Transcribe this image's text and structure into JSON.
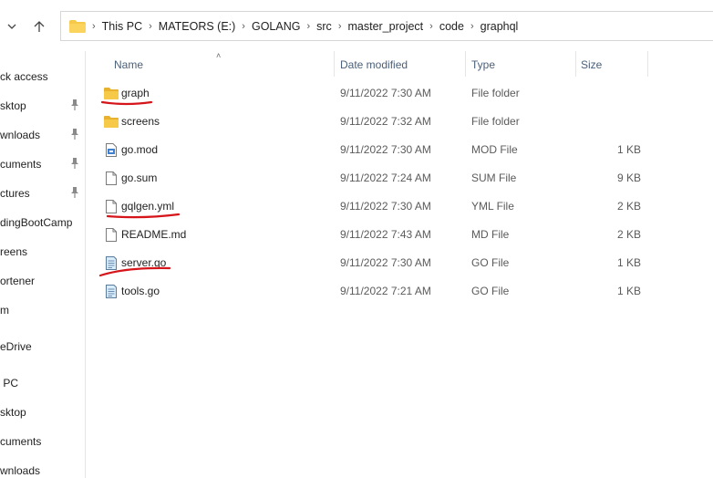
{
  "breadcrumbs": [
    "This PC",
    "MATEORS (E:)",
    "GOLANG",
    "src",
    "master_project",
    "code",
    "graphql"
  ],
  "sidebar": {
    "items": [
      {
        "label": "ck access",
        "pinned": false
      },
      {
        "label": "sktop",
        "pinned": true
      },
      {
        "label": "wnloads",
        "pinned": true
      },
      {
        "label": "cuments",
        "pinned": true
      },
      {
        "label": "ctures",
        "pinned": true
      },
      {
        "label": "dingBootCamp",
        "pinned": false
      },
      {
        "label": "reens",
        "pinned": false
      },
      {
        "label": "ortener",
        "pinned": false
      },
      {
        "label": "m",
        "pinned": false
      },
      {
        "label": "eDrive",
        "pinned": false
      },
      {
        "label": " PC",
        "pinned": false
      },
      {
        "label": "sktop",
        "pinned": false
      },
      {
        "label": "cuments",
        "pinned": false
      },
      {
        "label": "wnloads",
        "pinned": false
      }
    ]
  },
  "columns": {
    "name": "Name",
    "date": "Date modified",
    "type": "Type",
    "size": "Size"
  },
  "files": [
    {
      "name": "graph",
      "date": "9/11/2022 7:30 AM",
      "type": "File folder",
      "size": "",
      "icon": "folder-icon",
      "underlined": true
    },
    {
      "name": "screens",
      "date": "9/11/2022 7:32 AM",
      "type": "File folder",
      "size": "",
      "icon": "folder-icon",
      "underlined": false
    },
    {
      "name": "go.mod",
      "date": "9/11/2022 7:30 AM",
      "type": "MOD File",
      "size": "1 KB",
      "icon": "mod-file-icon",
      "underlined": false
    },
    {
      "name": "go.sum",
      "date": "9/11/2022 7:24 AM",
      "type": "SUM File",
      "size": "9 KB",
      "icon": "file-icon",
      "underlined": false
    },
    {
      "name": "gqlgen.yml",
      "date": "9/11/2022 7:30 AM",
      "type": "YML File",
      "size": "2 KB",
      "icon": "file-icon",
      "underlined": true
    },
    {
      "name": "README.md",
      "date": "9/11/2022 7:43 AM",
      "type": "MD File",
      "size": "2 KB",
      "icon": "file-icon",
      "underlined": false
    },
    {
      "name": "server.go",
      "date": "9/11/2022 7:30 AM",
      "type": "GO File",
      "size": "1 KB",
      "icon": "go-file-icon",
      "underlined": true
    },
    {
      "name": "tools.go",
      "date": "9/11/2022 7:21 AM",
      "type": "GO File",
      "size": "1 KB",
      "icon": "go-file-icon",
      "underlined": false
    }
  ],
  "icons": {
    "back": "chevron-down-icon",
    "up": "up-arrow-icon"
  },
  "colors": {
    "folder": "#f7c948",
    "annotation": "#d6151b",
    "header_text": "#4c607a"
  }
}
